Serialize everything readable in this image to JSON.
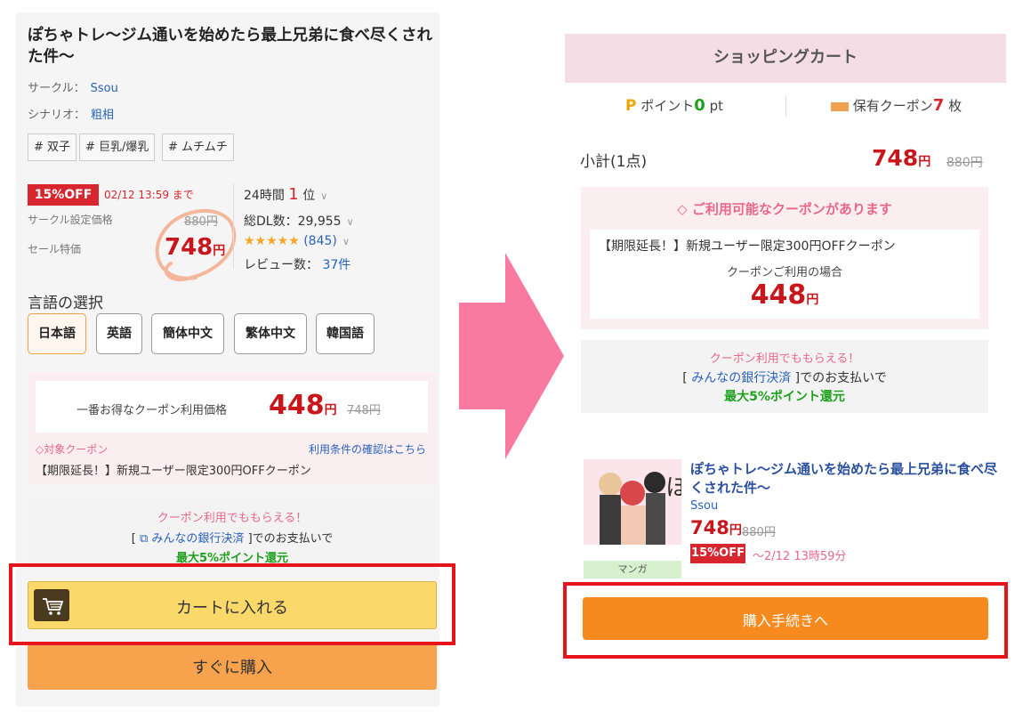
{
  "left": {
    "title": "ぽちゃトレ〜ジム通いを始めたら最上兄弟に食べ尽くされた件〜",
    "circle_label": "サークル：",
    "circle_value": "Ssou",
    "scenario_label": "シナリオ：",
    "scenario_value": "粗相",
    "tags": [
      "# 双子",
      "# 巨乳/爆乳",
      "# ムチムチ"
    ],
    "discount_badge": "15%OFF",
    "sale_deadline": "02/12 13:59 まで",
    "list_price_label": "サークル設定価格",
    "list_price": "880円",
    "sale_price_label": "セール特価",
    "sale_price": "748",
    "yen": "円",
    "rank_label": "24時間",
    "rank_value": "1",
    "rank_unit": "位",
    "downloads": "総DL数：29,955",
    "stars": "★★★★★",
    "rating_count": "(845)",
    "reviews_label": "レビュー数：",
    "reviews_value": "37件",
    "language_title": "言語の選択",
    "languages": [
      "日本語",
      "英語",
      "簡体中文",
      "繁体中文",
      "韓国語"
    ],
    "best_coupon_label": "一番お得なクーポン利用価格",
    "best_coupon_price": "448",
    "best_coupon_old": "748円",
    "target_coupon_label": "対象クーポン",
    "terms_link": "利用条件の確認はこちら",
    "coupon_name": "【期限延長！】新規ユーザー限定300円OFFクーポン",
    "bank_headline": "クーポン利用でももらえる！",
    "bank_pre": "[",
    "bank_link": "みんなの銀行決済",
    "bank_post": "]でのお支払いで",
    "bank_reward": "最大5%ポイント還元",
    "cart_button": "カートに入れる",
    "buy_now_button": "すぐに購入"
  },
  "right": {
    "header": "ショッピングカート",
    "points_label": "ポイント",
    "points_value": "0",
    "points_unit": "pt",
    "coupons_label": "保有クーポン",
    "coupons_value": "7",
    "coupons_unit": "枚",
    "subtotal_label": "小計(1点)",
    "subtotal_price": "748",
    "subtotal_old": "880円",
    "coupon_avail": "ご利用可能なクーポンがあります",
    "coupon_name": "【期限延長！】新規ユーザー限定300円OFFクーポン",
    "coupon_use_label": "クーポンご利用の場合",
    "coupon_price": "448",
    "bank_headline": "クーポン利用でももらえる！",
    "bank_pre": "[",
    "bank_link": "みんなの銀行決済",
    "bank_post": "]でのお支払いで",
    "bank_reward": "最大5%ポイント還元",
    "product_title": "ぽちゃトレ〜ジム通いを始めたら最上兄弟に食べ尽くされた件〜",
    "product_circle": "Ssou",
    "product_price": "748",
    "product_old": "880円",
    "product_badge": "15%OFF",
    "product_deadline": "〜2/12 13時59分",
    "product_category": "マンガ",
    "proceed_button": "購入手続きへ"
  },
  "colors": {
    "sale_red": "#c9161d",
    "cart_yellow": "#fbd86a",
    "buy_orange": "#f7a24d",
    "proceed_orange": "#f78a1e",
    "highlight_frame": "#e8141b",
    "arrow_pink": "#f87aa0"
  }
}
